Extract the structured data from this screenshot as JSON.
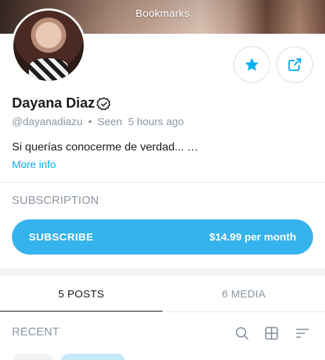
{
  "header": {
    "title": "Bookmarks"
  },
  "profile": {
    "name": "Dayana Diaz",
    "handle": "@dayanadiazu",
    "separator": "•",
    "seen": "Seen  5 hours ago",
    "bio": "Si querías conocerme de verdad... …",
    "more_info": "More info"
  },
  "subscription": {
    "label": "SUBSCRIPTION",
    "button_label": "SUBSCRIBE",
    "price": "$14.99 per month"
  },
  "tabs": [
    {
      "label": "5 POSTS",
      "active": true
    },
    {
      "label": "6 MEDIA",
      "active": false
    }
  ],
  "feed": {
    "recent_label": "RECENT"
  },
  "colors": {
    "accent": "#00aff0",
    "button": "#35b3ec",
    "muted": "#8a96a3"
  },
  "icons": [
    "star-icon",
    "share-icon",
    "verified-icon",
    "search-icon",
    "grid-icon",
    "sort-icon"
  ]
}
